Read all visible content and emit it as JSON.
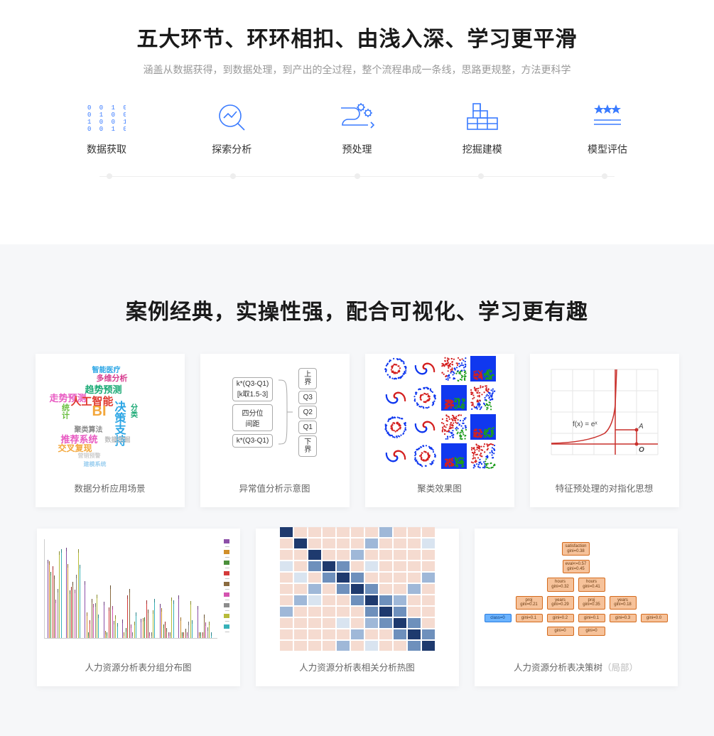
{
  "section1": {
    "title": "五大环节、环环相扣、由浅入深、学习更平滑",
    "subtitle": "涵盖从数据获得，到数据处理，到产出的全过程，整个流程串成一条线，思路更规整，方法更科学",
    "steps": [
      {
        "label": "数据获取",
        "icon": "binary-grid-icon"
      },
      {
        "label": "探索分析",
        "icon": "magnify-chart-icon"
      },
      {
        "label": "预处理",
        "icon": "gears-flow-icon"
      },
      {
        "label": "挖掘建模",
        "icon": "blocks-icon"
      },
      {
        "label": "模型评估",
        "icon": "stars-underline-icon"
      }
    ]
  },
  "section2": {
    "title": "案例经典，实操性强，配合可视化、学习更有趣",
    "cards_row1": [
      {
        "caption": "数据分析应用场景",
        "wordcloud": [
          "智能医疗",
          "多维分析",
          "趋势预测",
          "走势预测",
          "人工智能",
          "BI",
          "决策支持",
          "统计",
          "分类",
          "聚类算法",
          "推荐系统",
          "交叉复现",
          "数据挖掘",
          "营销预警",
          "建模系统"
        ]
      },
      {
        "caption": "异常值分析示意图",
        "quartile": {
          "left": [
            "k*(Q3-Q1)",
            "[k取1.5-3]",
            "四分位",
            "间距",
            "k*(Q3-Q1)"
          ],
          "right": [
            "上界",
            "Q3",
            "Q2",
            "Q1",
            "下界"
          ]
        }
      },
      {
        "caption": "聚类效果图"
      },
      {
        "caption": "特征预处理的对指化思想",
        "math": {
          "fx": "f(x) = eˣ",
          "A": "A",
          "O": "O"
        }
      }
    ],
    "cards_row2": [
      {
        "caption": "人力资源分析表分组分布图"
      },
      {
        "caption": "人力资源分析表相关分析热图"
      },
      {
        "caption_main": "人力资源分析表决策树",
        "caption_suffix": "（局部）"
      }
    ]
  }
}
